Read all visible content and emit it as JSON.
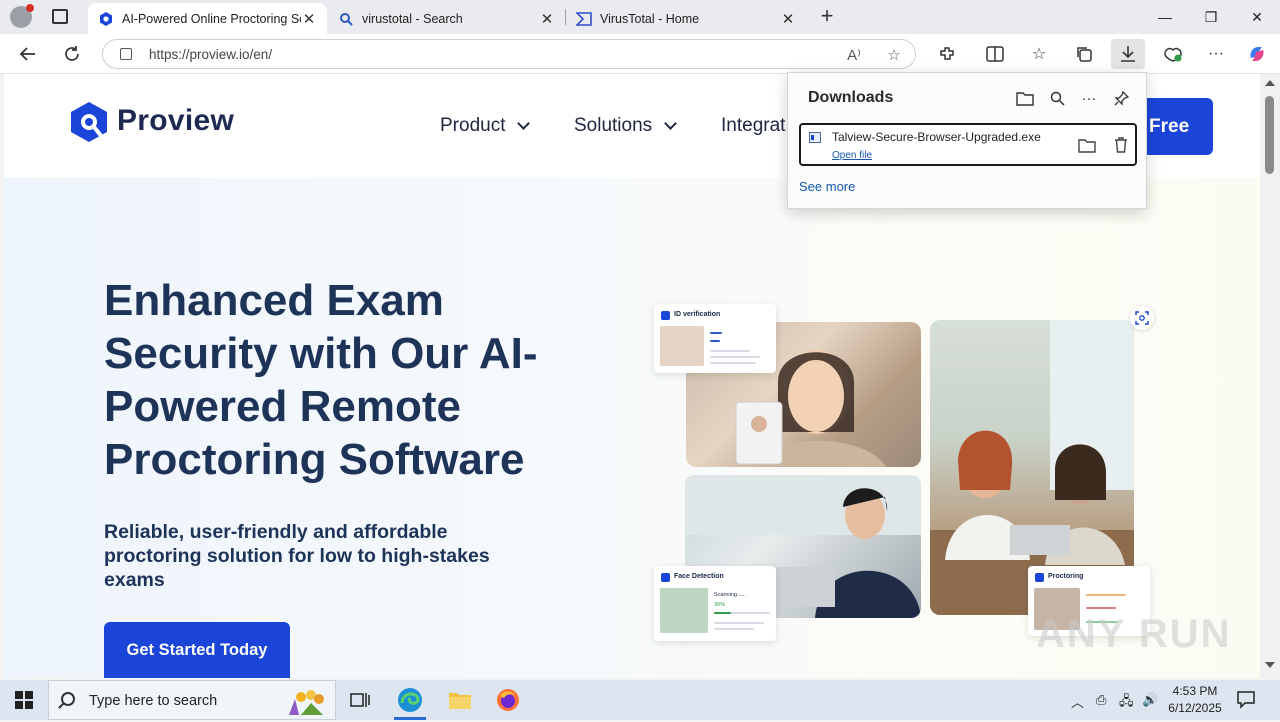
{
  "browser": {
    "tabs": [
      {
        "label": "AI-Powered Online Proctoring So",
        "active": true
      },
      {
        "label": "virustotal - Search",
        "active": false
      },
      {
        "label": "VirusTotal - Home",
        "active": false
      }
    ],
    "new_tab": "+",
    "window_controls": {
      "minimize": "—",
      "restore": "❐",
      "close": "✕"
    },
    "url": "https://proview.io/en/"
  },
  "site": {
    "logo_text": "Proview",
    "nav": [
      {
        "label": "Product"
      },
      {
        "label": "Solutions"
      },
      {
        "label": "Integrat"
      }
    ],
    "header_cta": "Free",
    "hero": {
      "title": "Enhanced Exam Security with Our AI-Powered Remote Proctoring Software",
      "subtitle": "Reliable, user-friendly and affordable proctoring solution for low to high-stakes exams",
      "cta": "Get Started Today"
    },
    "cards": {
      "id_verification": "ID verification",
      "face_detection": "Face Detection",
      "face_detection_status": "Scanning......",
      "face_detection_percent": "30%",
      "proctoring": "Proctoring"
    }
  },
  "downloads": {
    "title": "Downloads",
    "item": {
      "file_name": "Talview-Secure-Browser-Upgraded.exe",
      "action": "Open file"
    },
    "see_more": "See more"
  },
  "taskbar": {
    "search_placeholder": "Type here to search",
    "time": "4:53 PM",
    "date": "6/12/2025"
  },
  "colors": {
    "brand_blue": "#1b45d8",
    "heading_navy": "#1d3358"
  },
  "watermark": "ANY RUN"
}
